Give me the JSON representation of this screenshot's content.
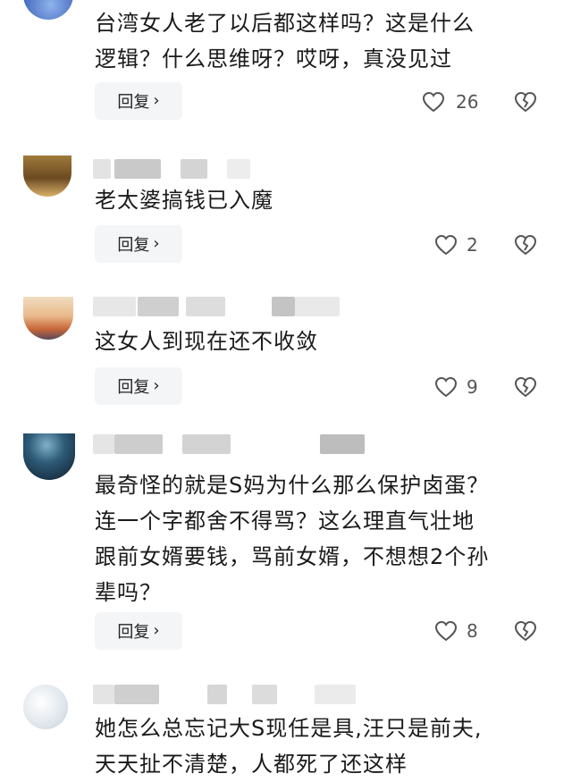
{
  "comments": [
    {
      "text": "台湾女人老了以后都这样吗？这是什么\n逻辑？什么思维呀？哎呀，真没见过",
      "reply_label": "回复",
      "likes": "26",
      "avatar_colors": [
        "#3a5fb8",
        "#8fb4ec"
      ]
    },
    {
      "text": "老太婆搞钱已入魔",
      "reply_label": "回复",
      "likes": "2",
      "avatar_colors": [
        "#8a6a3a",
        "#d8b06a"
      ]
    },
    {
      "text": "这女人到现在还不收敛",
      "reply_label": "回复",
      "likes": "9",
      "avatar_colors": [
        "#e9c9a0",
        "#d9874f"
      ]
    },
    {
      "text": "最奇怪的就是S妈为什么那么保护卤蛋？\n连一个字都舍不得骂？这么理直气壮地\n跟前女婿要钱，骂前女婿，不想想2个孙\n辈吗？",
      "reply_label": "回复",
      "likes": "8",
      "avatar_colors": [
        "#1f3d55",
        "#6aa1b8"
      ]
    },
    {
      "text": "她怎么总忘记大S现任是具,汪只是前夫,\n天天扯不清楚，人都死了还这样",
      "avatar_colors": [
        "#c9d3dc",
        "#eef2f5"
      ]
    }
  ]
}
